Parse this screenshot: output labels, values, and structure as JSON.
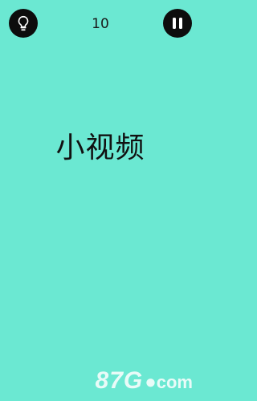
{
  "header": {
    "score": "10",
    "hint_icon": "lightbulb-icon",
    "pause_icon": "pause-icon"
  },
  "main": {
    "word": "小视频"
  },
  "watermark": {
    "main": "87G",
    "dot": "●",
    "tld": "com"
  },
  "colors": {
    "background": "#6be8d2",
    "button": "#0d0d0d",
    "icon": "#ffffff",
    "text": "#111111"
  }
}
